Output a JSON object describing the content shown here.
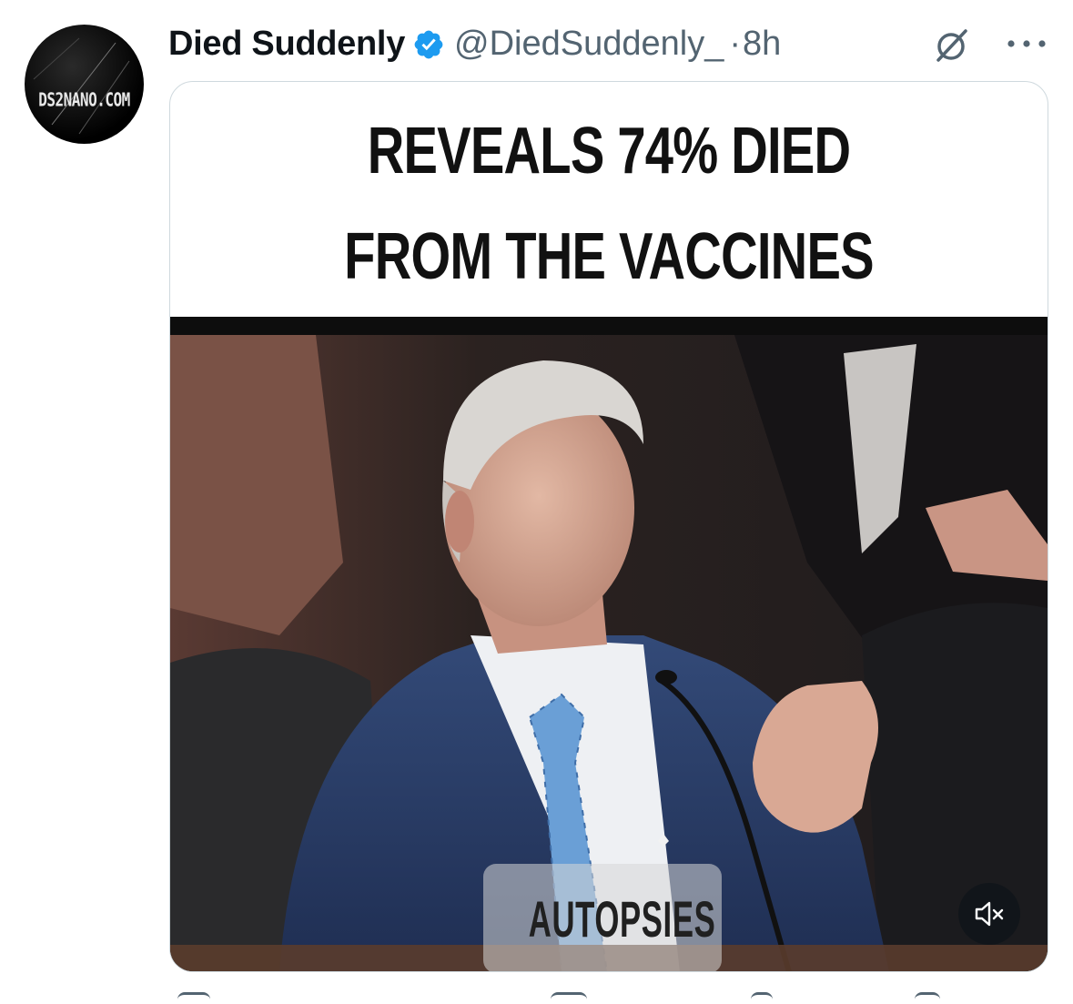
{
  "avatar": {
    "label": "DS2NANO.COM"
  },
  "post": {
    "display_name": "Died Suddenly",
    "handle": "@DiedSuddenly_",
    "separator": "·",
    "time": "8h",
    "verified_color": "#1d9bf0"
  },
  "media": {
    "headline_line1": "REVEALS 74% DIED",
    "headline_line2": "FROM THE VACCINES",
    "caption": "AUTOPSIES",
    "mute_icon": "speaker-muted-icon"
  },
  "icons": {
    "grok": "grok-slash-icon",
    "more": "more-horizontal-icon"
  }
}
